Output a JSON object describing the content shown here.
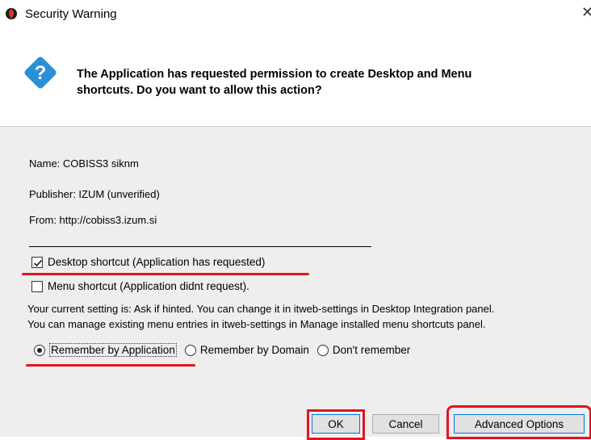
{
  "window": {
    "title": "Security Warning",
    "close_glyph": "✕",
    "app_icon": "java-cup-icon"
  },
  "header": {
    "icon": "question-icon",
    "message_line1": "The Application has requested permission to create Desktop and Menu",
    "message_line2": "shortcuts. Do you want to allow this action?"
  },
  "info": {
    "name": "Name:  COBISS3 siknm",
    "publisher": "Publisher: IZUM (unverified)",
    "from": "From:  http://cobiss3.izum.si"
  },
  "options": {
    "desktop_shortcut": {
      "label": "Desktop shortcut (Application has requested)",
      "checked": true
    },
    "menu_shortcut": {
      "label": "Menu shortcut (Application didnt request).",
      "checked": false
    }
  },
  "note": {
    "line1": "Your current setting is: Ask if hinted. You can change it in itweb-settings in Desktop Integration panel.",
    "line2": "You can manage existing menu entries in itweb-settings in Manage installed menu shortcuts panel."
  },
  "remember": {
    "options": [
      {
        "label": "Remember by Application",
        "selected": true
      },
      {
        "label": "Remember by Domain",
        "selected": false
      },
      {
        "label": "Don't remember",
        "selected": false
      }
    ]
  },
  "buttons": {
    "ok": "OK",
    "cancel": "Cancel",
    "advanced": "Advanced Options"
  },
  "colors": {
    "highlight": "#e2141e",
    "question_icon": "#2a8fd6",
    "panel_bg": "#eeeeee"
  }
}
